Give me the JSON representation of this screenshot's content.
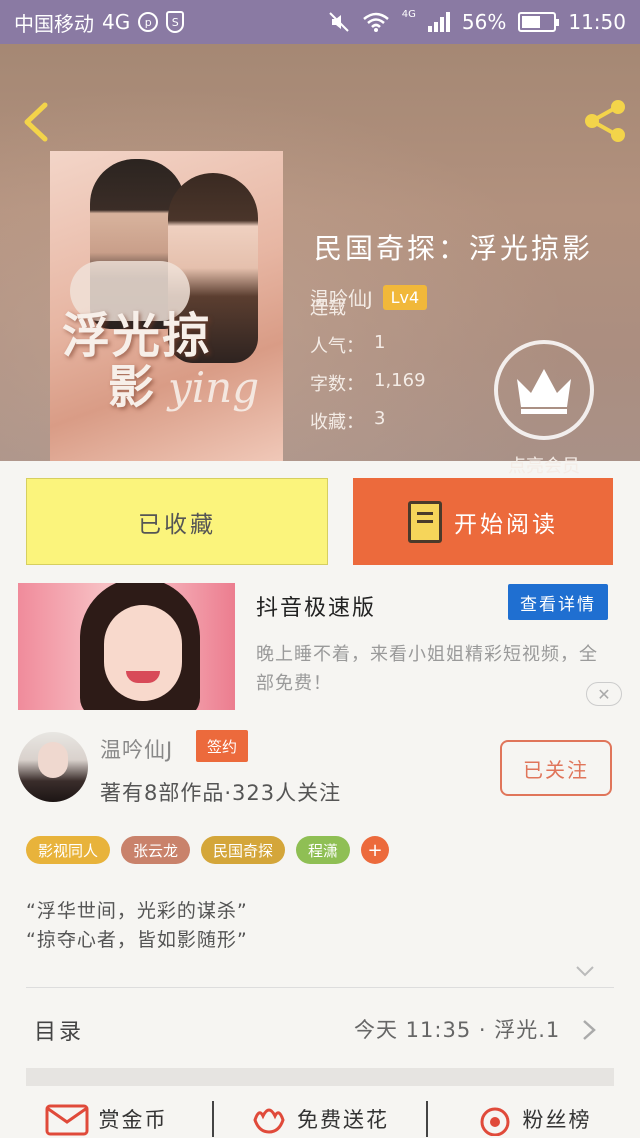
{
  "status_bar": {
    "carrier": "中国移动",
    "network": "4G",
    "signal_tag": "4G",
    "battery": "56%",
    "time": "11:50"
  },
  "header": {
    "back_icon": "chevron-left-icon",
    "share_icon": "share-icon"
  },
  "book": {
    "cover_title_line1": "浮光掠",
    "cover_title_line2": "影",
    "cover_title_script": "ying",
    "title": "民国奇探：浮光掠影",
    "author": "温吟仙J",
    "level": "Lv4",
    "status": "连载",
    "popularity_label": "人气：",
    "popularity": "1",
    "words_label": "字数：",
    "words": "1,169",
    "favorites_label": "收藏：",
    "favorites": "3",
    "vip_label": "点亮会员"
  },
  "actions": {
    "collected": "已收藏",
    "start_reading": "开始阅读"
  },
  "ad": {
    "title": "抖音极速版",
    "detail_button": "查看详情",
    "description": "晚上睡不着，来看小姐姐精彩短视频，全部免费！",
    "close": "✕"
  },
  "author_card": {
    "name": "温吟仙J",
    "badge": "签约",
    "stats": "著有8部作品·323人关注",
    "follow_button": "已关注"
  },
  "tags": [
    {
      "label": "影视同人",
      "color": "#e8b33b"
    },
    {
      "label": "张云龙",
      "color": "#c9826b"
    },
    {
      "label": "民国奇探",
      "color": "#d4a63a"
    },
    {
      "label": "程潇",
      "color": "#8fbf54"
    }
  ],
  "tag_more": "+",
  "intro": {
    "line1": "“浮华世间，光彩的谋杀”",
    "line2": "“掠夺心者，皆如影随形”"
  },
  "toc": {
    "label": "目录",
    "latest": "今天 11:35 · 浮光.1"
  },
  "bottom_bar": {
    "reward": "赏金币",
    "flowers": "免费送花",
    "fans": "粉丝榜"
  },
  "colors": {
    "accent": "#ec6a3c",
    "collected_bg": "#fbf47c",
    "status_bar_bg": "#8a7aa3",
    "detail_blue": "#1f6fd1"
  }
}
